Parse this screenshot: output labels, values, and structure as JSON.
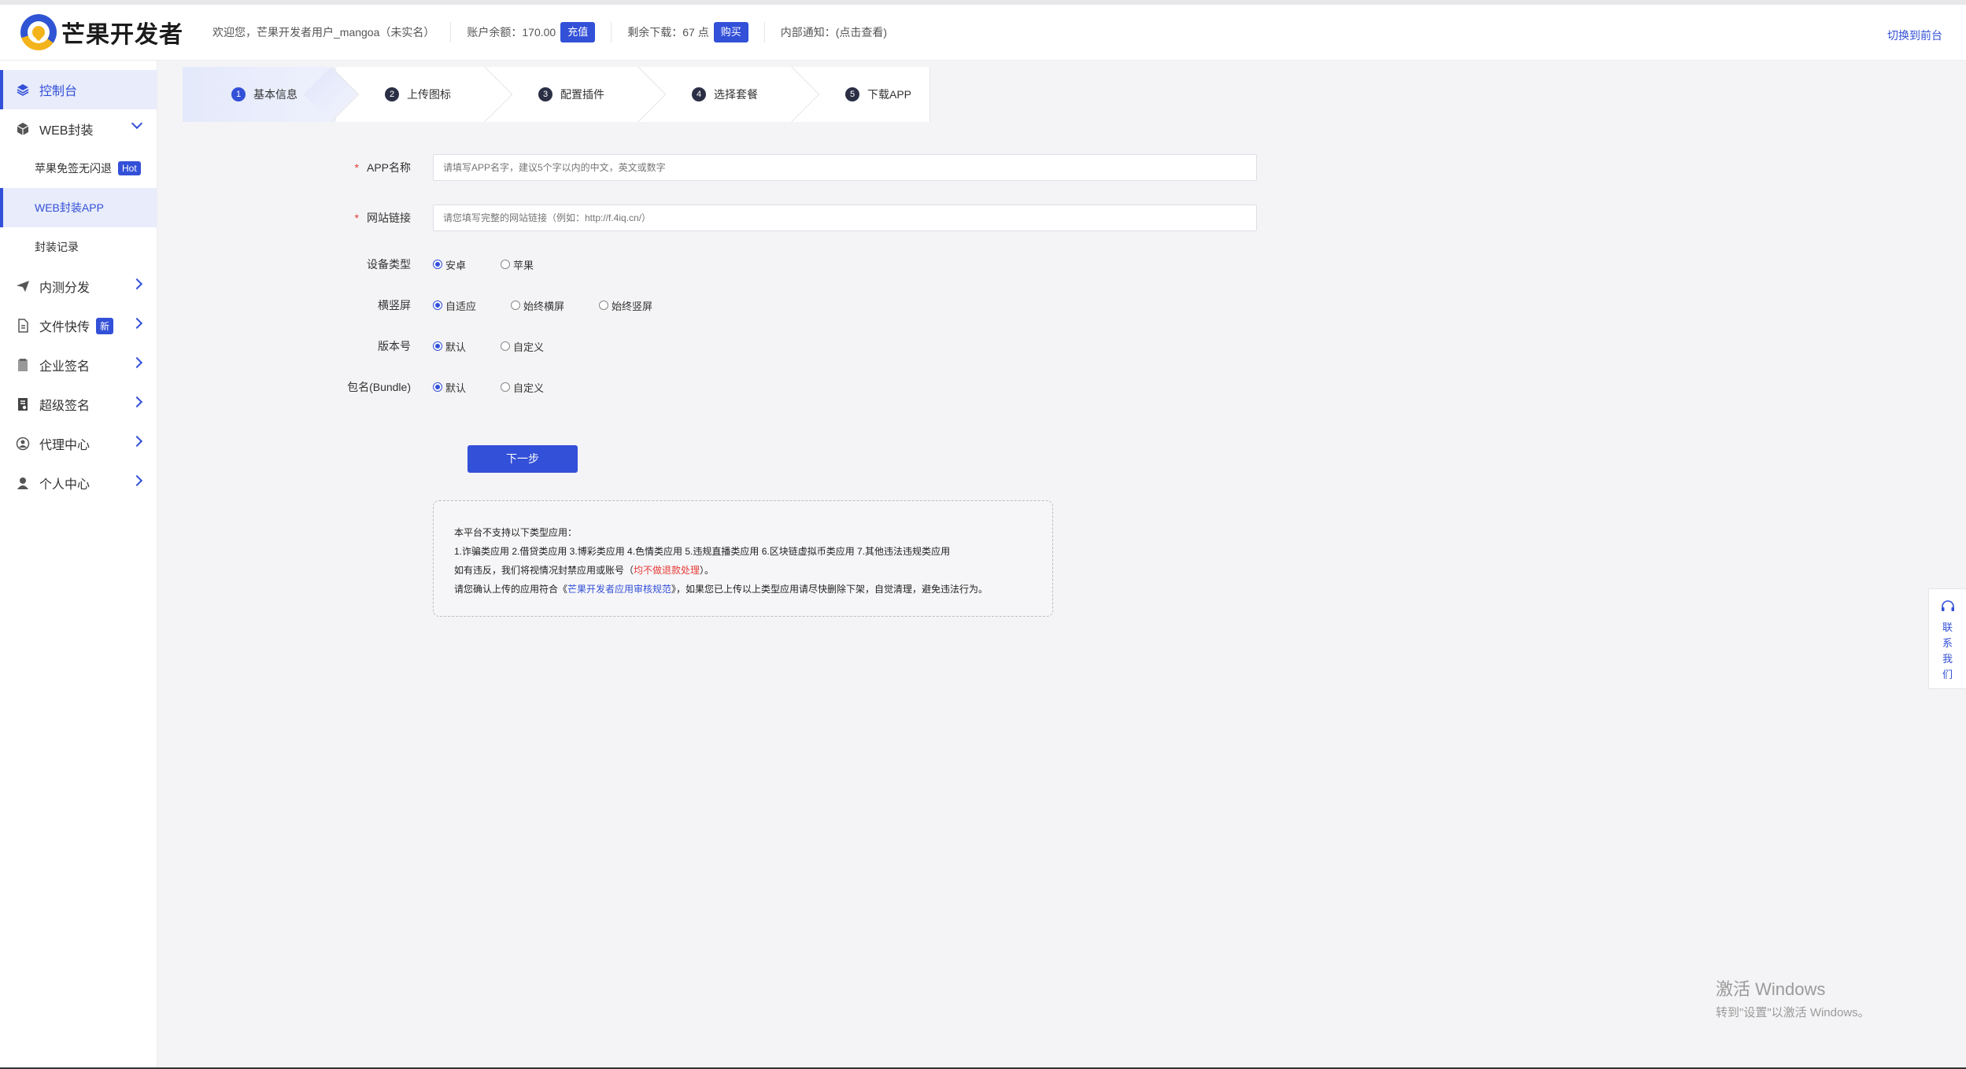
{
  "header": {
    "logo_text": "芒果开发者",
    "welcome": "欢迎您，芒果开发者用户_mangoa（未实名）",
    "balance_label": "账户余额：170.00",
    "recharge_label": "充值",
    "downloads_label": "剩余下载：67 点",
    "buy_label": "购买",
    "notice_label": "内部通知：(点击查看)",
    "switch_label": "切换到前台"
  },
  "sidebar": {
    "items": [
      {
        "label": "控制台"
      },
      {
        "label": "WEB封装"
      },
      {
        "label": "苹果免签无闪退",
        "badge": "Hot"
      },
      {
        "label": "WEB封装APP"
      },
      {
        "label": "封装记录"
      },
      {
        "label": "内测分发"
      },
      {
        "label": "文件快传",
        "badge": "新"
      },
      {
        "label": "企业签名"
      },
      {
        "label": "超级签名"
      },
      {
        "label": "代理中心"
      },
      {
        "label": "个人中心"
      }
    ]
  },
  "steps": [
    {
      "num": "1",
      "label": "基本信息"
    },
    {
      "num": "2",
      "label": "上传图标"
    },
    {
      "num": "3",
      "label": "配置插件"
    },
    {
      "num": "4",
      "label": "选择套餐"
    },
    {
      "num": "5",
      "label": "下载APP"
    }
  ],
  "form": {
    "app_name": {
      "label": "APP名称",
      "placeholder": "请填写APP名字，建议5个字以内的中文，英文或数字"
    },
    "site_url": {
      "label": "网站链接",
      "placeholder": "请您填写完整的网站链接（例如：http://f.4iq.cn/）"
    },
    "device": {
      "label": "设备类型",
      "options": [
        "安卓",
        "苹果"
      ],
      "selected": "安卓"
    },
    "orientation": {
      "label": "横竖屏",
      "options": [
        "自适应",
        "始终横屏",
        "始终竖屏"
      ],
      "selected": "自适应"
    },
    "version": {
      "label": "版本号",
      "options": [
        "默认",
        "自定义"
      ],
      "selected": "默认"
    },
    "bundle": {
      "label": "包名(Bundle)",
      "options": [
        "默认",
        "自定义"
      ],
      "selected": "默认"
    },
    "next_label": "下一步"
  },
  "notice": {
    "line1": "本平台不支持以下类型应用：",
    "line2": "1.诈骗类应用 2.借贷类应用 3.博彩类应用 4.色情类应用 5.违规直播类应用 6.区块链虚拟币类应用 7.其他违法违规类应用",
    "line3_a": "如有违反，我们将视情况封禁应用或账号（",
    "line3_red": "均不做退款处理",
    "line3_b": "）。",
    "line4_a": "请您确认上传的应用符合《",
    "line4_link": "芒果开发者应用审核规范",
    "line4_b": "》，如果您已上传以上类型应用请尽快删除下架，自觉清理，避免违法行为。"
  },
  "contact": {
    "chars": [
      "联",
      "系",
      "我",
      "们"
    ]
  },
  "watermark": {
    "line1": "激活 Windows",
    "line2": "转到\"设置\"以激活 Windows。"
  },
  "colors": {
    "accent": "#3350d8",
    "danger": "#e53935"
  }
}
